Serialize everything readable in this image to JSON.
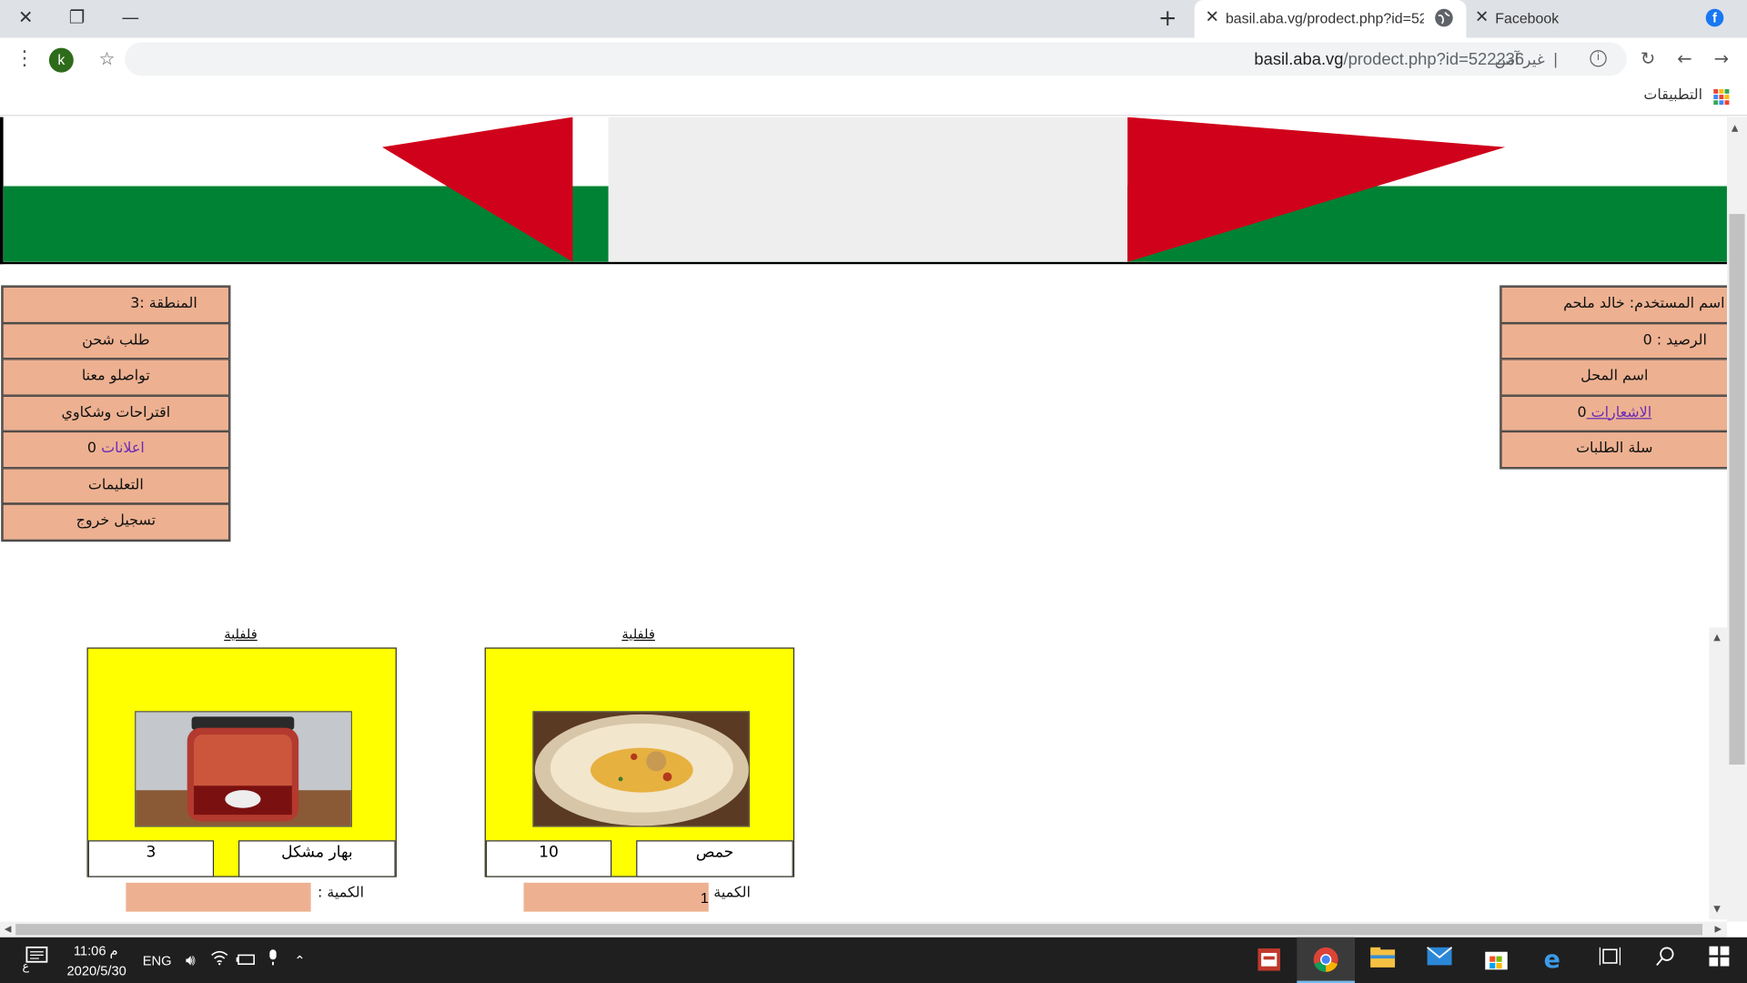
{
  "browser": {
    "active_tab_title": "basil.aba.vg/prodect.php?id=522",
    "inactive_tab_title": "Facebook",
    "url_host": "basil.aba.vg",
    "url_path": "/prodect.php?id=522236",
    "security_label": "غير آمن",
    "profile_initial": "k",
    "bookmarks_apps_label": "التطبيقات"
  },
  "user_panel": {
    "username_row": "اسم المستخدم: خالد ملحم",
    "balance_row": "الرصيد : 0",
    "shop_name_row": "اسم المحل",
    "notifications_link": "الاشعارات ",
    "notifications_count": "0",
    "orders_basket_row": "سلة الطلبات"
  },
  "menu_panel": {
    "region_row": "المنطقة :3",
    "shipping_request": "طلب شحن",
    "contact_us": "تواصلو معنا",
    "suggestions": "اقتراحات وشكاوي",
    "ads_link": "اعلانات",
    "ads_count": " 0",
    "instructions": "التعليمات",
    "logout": "تسجيل خروج"
  },
  "products": [
    {
      "category": "فلفلية",
      "name": "بهار مشكل",
      "price": "3",
      "quantity_label": "الكمية :",
      "quantity_value": ""
    },
    {
      "category": "فلفلية",
      "name": "حمص",
      "price": "10",
      "quantity_label": "الكمية :",
      "quantity_value": "1"
    }
  ],
  "taskbar": {
    "time": "11:06 م",
    "date": "2020/5/30",
    "language": "ENG",
    "keyboard_indicator": "ع"
  },
  "colors": {
    "flag_red": "#d0021b",
    "flag_green": "#008234",
    "flag_white": "#eeeeee",
    "panel_bg": "#edb191",
    "card_bg": "#ffff00",
    "link": "#6c2bb5"
  }
}
